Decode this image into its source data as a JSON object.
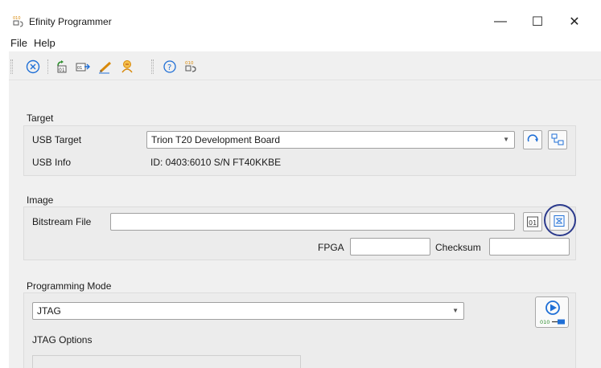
{
  "window": {
    "title": "Efinity Programmer",
    "controls": {
      "minimize": "—",
      "maximize": "☐",
      "close": "✕"
    }
  },
  "menu": {
    "items": [
      "File",
      "Help"
    ]
  },
  "toolbar": {
    "buttons": [
      "close-circle-icon",
      "open-bitstream-icon",
      "export-icon",
      "edit-icon",
      "debug-person-icon",
      "help-icon",
      "program-icon"
    ]
  },
  "target": {
    "group_label": "Target",
    "usb_target_label": "USB Target",
    "usb_target_value": "Trion T20 Development Board",
    "usb_info_label": "USB Info",
    "usb_info_value": "ID: 0403:6010 S/N FT40KKBE"
  },
  "image": {
    "group_label": "Image",
    "bitstream_label": "Bitstream File",
    "bitstream_value": "",
    "fpga_label": "FPGA",
    "fpga_value": "",
    "checksum_label": "Checksum",
    "checksum_value": "",
    "select_bitstream_glyph": "01"
  },
  "programming_mode": {
    "group_label": "Programming Mode",
    "mode_value": "JTAG",
    "jtag_options_label": "JTAG Options",
    "start_program_text": "010"
  },
  "colors": {
    "accent_blue": "#1f6fd6",
    "highlight_ring": "#2b3a8c",
    "icon_orange": "#d8890b",
    "icon_green": "#2f8f2f"
  }
}
